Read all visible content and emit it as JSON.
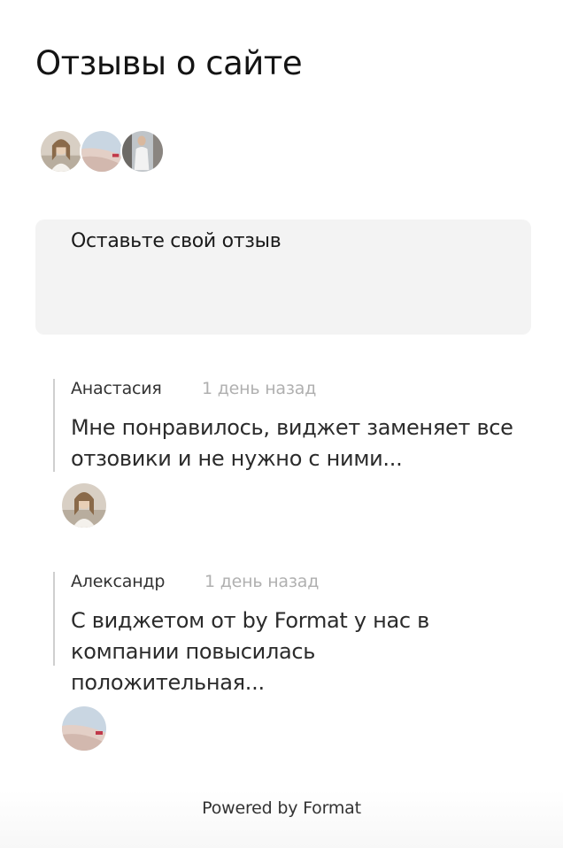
{
  "page": {
    "title": "Отзывы о сайте"
  },
  "form": {
    "placeholder": "Оставьте свой отзыв"
  },
  "reviews": [
    {
      "author": "Анастасия",
      "time": "1 день назад",
      "text": "Мне понравилось, виджет заменяет все отзовики и не нужно с ними..."
    },
    {
      "author": "Александр",
      "time": "1 день назад",
      "text": "С виджетом от by Format у нас в компании повысилась положительная..."
    }
  ],
  "footer": {
    "label": "Powered by Format"
  },
  "colors": {
    "form_background": "#f3f3f3",
    "timestamp": "#b0b0b0",
    "quote_bar": "#cfcfcf"
  }
}
